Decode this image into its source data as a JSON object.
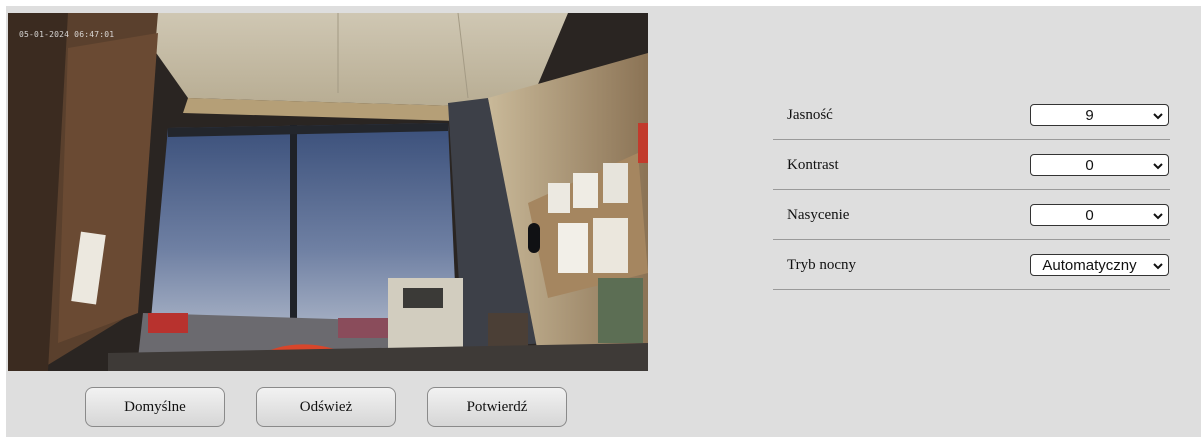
{
  "camera": {
    "timestamp": "05-01-2024 06:47:01"
  },
  "buttons": {
    "defaults_label": "Domyślne",
    "refresh_label": "Odśwież",
    "confirm_label": "Potwierdź"
  },
  "settings": [
    {
      "label": "Jasność",
      "value": "9"
    },
    {
      "label": "Kontrast",
      "value": "0"
    },
    {
      "label": "Nasycenie",
      "value": "0"
    },
    {
      "label": "Tryb nocny",
      "value": "Automatyczny"
    }
  ],
  "icons": {
    "select_arrow": "chevron-down-icon"
  },
  "colors": {
    "panel_bg": "#dedede",
    "button_bg": "#e4e4e4"
  }
}
